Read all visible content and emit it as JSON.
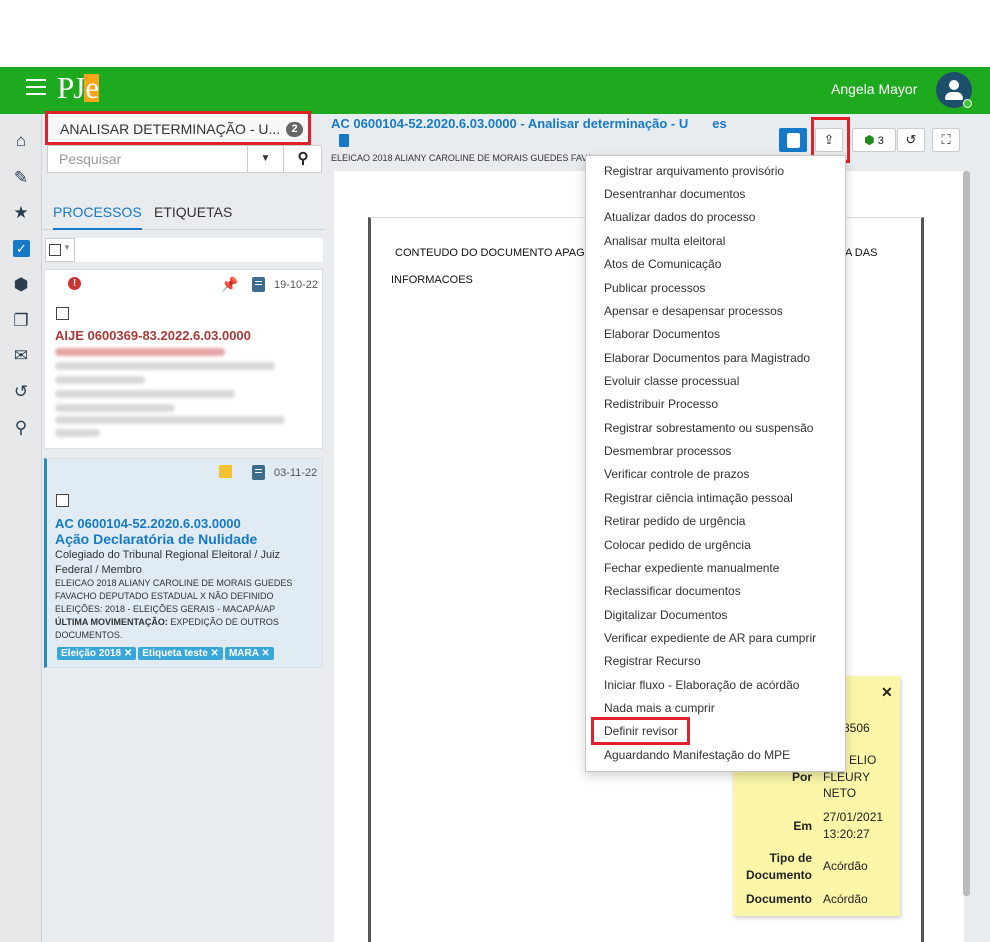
{
  "header": {
    "logo": "PJ",
    "logo_e": "e",
    "user_name": "Angela Mayor"
  },
  "sidebar_task": {
    "title": "ANALISAR DETERMINAÇÃO - U...",
    "count": "2",
    "search_placeholder": "Pesquisar"
  },
  "tabs": [
    "PROCESSOS",
    "ETIQUETAS"
  ],
  "cards": [
    {
      "date": "19-10-22",
      "process": "AIJE 0600369-83.2022.6.03.0000"
    },
    {
      "date": "03-11-22",
      "process": "AC 0600104-52.2020.6.03.0000",
      "class": "Ação Declaratória de Nulidade",
      "orgao": "Colegiado do Tribunal Regional Eleitoral / Juiz Federal / Membro",
      "parts": "ELEICAO 2018 ALIANY CAROLINE DE MORAIS GUEDES FAVACHO DEPUTADO ESTADUAL X NÃO DEFINIDO",
      "elections": "ELEIÇÕES: 2018 - ELEIÇÕES GERAIS - MACAPÁ/AP",
      "last_mov_label": "ÚLTIMA MOVIMENTAÇÃO:",
      "last_mov_value": "EXPEDIÇÃO DE OUTROS",
      "last_mov_value2": "DOCUMENTOS.",
      "tags": [
        "Eleição 2018 ✕",
        "Etiqueta teste ✕",
        "MARA ✕"
      ]
    }
  ],
  "main": {
    "process_title": "AC 0600104-52.2020.6.03.0000 - Analisar determinação - U",
    "process_title_end": "es",
    "parts_line": "ELEICAO 2018 ALIANY CAROLINE DE MORAIS GUEDES FAVA",
    "tag_count": "3",
    "doc_text_1": "CONTEUDO DO DOCUMENTO APAG",
    "doc_text_1_end": "A DAS",
    "doc_text_2": "INFORMACOES"
  },
  "menu": {
    "items": [
      "Registrar arquivamento provisório",
      "Desentranhar documentos",
      "Atualizar dados do processo",
      "Analisar multa eleitoral",
      "Atos de Comunicação",
      "Publicar processos",
      "Apensar e desapensar processos",
      "Elaborar Documentos",
      "Elaborar Documentos para Magistrado",
      "Evoluir classe processual",
      "Redistribuir Processo",
      "Registrar sobrestamento ou suspensão",
      "Desmembrar processos",
      "Verificar controle de prazos",
      "Registrar ciência intimação pessoal",
      "Retirar pedido de urgência",
      "Colocar pedido de urgência",
      "Fechar expediente manualmente",
      "Reclassificar documentos",
      "Digitalizar Documentos",
      "Verificar expediente de AR para cumprir",
      "Registrar Recurso",
      "Iniciar fluxo - Elaboração de acórdão",
      "Nada mais a cumprir",
      "Definir revisor",
      "Aguardando Manifestação do MPE"
    ]
  },
  "sticky": {
    "id_frag": "3506",
    "por_label": "Por",
    "por_value1": "ELIO",
    "por_value2": "FLEURY",
    "por_value3": "NETO",
    "em_label": "Em",
    "em_value1": "27/01/2021",
    "em_value2": "13:20:27",
    "tipo_label1": "Tipo de",
    "tipo_label2": "Documento",
    "tipo_value": "Acórdão",
    "doc_label": "Documento",
    "doc_value": "Acórdão"
  },
  "colors": {
    "topbar": "#1eaa1e",
    "accent": "#1679c8",
    "highlight": "#e0202a",
    "sticky": "#fbf6a8"
  },
  "icons": [
    "menu-icon",
    "home-icon",
    "pencil-icon",
    "star-icon",
    "checkbox-icon",
    "tags-icon",
    "copy-icon",
    "envelope-icon",
    "history-icon",
    "search-icon",
    "pin-icon",
    "book-icon",
    "clipboard-icon",
    "share-icon",
    "tag-icon",
    "fullscreen-icon",
    "close-icon"
  ]
}
